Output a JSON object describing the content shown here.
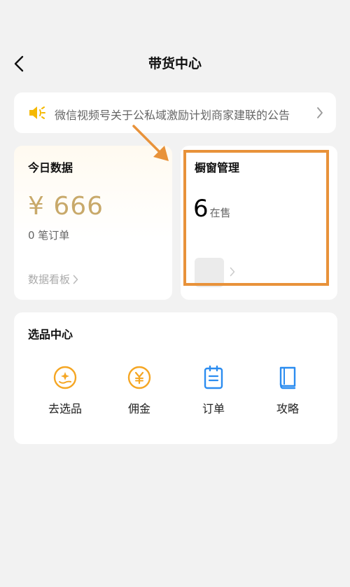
{
  "header": {
    "title": "带货中心"
  },
  "notice": {
    "text": "微信视频号关于公私域激励计划商家建联的公告"
  },
  "today": {
    "title": "今日数据",
    "amount": "¥ 666",
    "orders": "0 笔订单",
    "link_label": "数据看板"
  },
  "window": {
    "title": "橱窗管理",
    "count": "6",
    "count_label": "在售"
  },
  "select_center": {
    "title": "选品中心",
    "items": [
      {
        "label": "去选品",
        "icon": "coin-star-icon"
      },
      {
        "label": "佣金",
        "icon": "yuan-coin-icon"
      },
      {
        "label": "订单",
        "icon": "clipboard-icon"
      },
      {
        "label": "攻略",
        "icon": "book-icon"
      }
    ]
  },
  "colors": {
    "accent_orange": "#f5a623",
    "accent_blue": "#2b8cf0",
    "money_gold": "#c8a96a",
    "highlight": "#e8923a"
  }
}
